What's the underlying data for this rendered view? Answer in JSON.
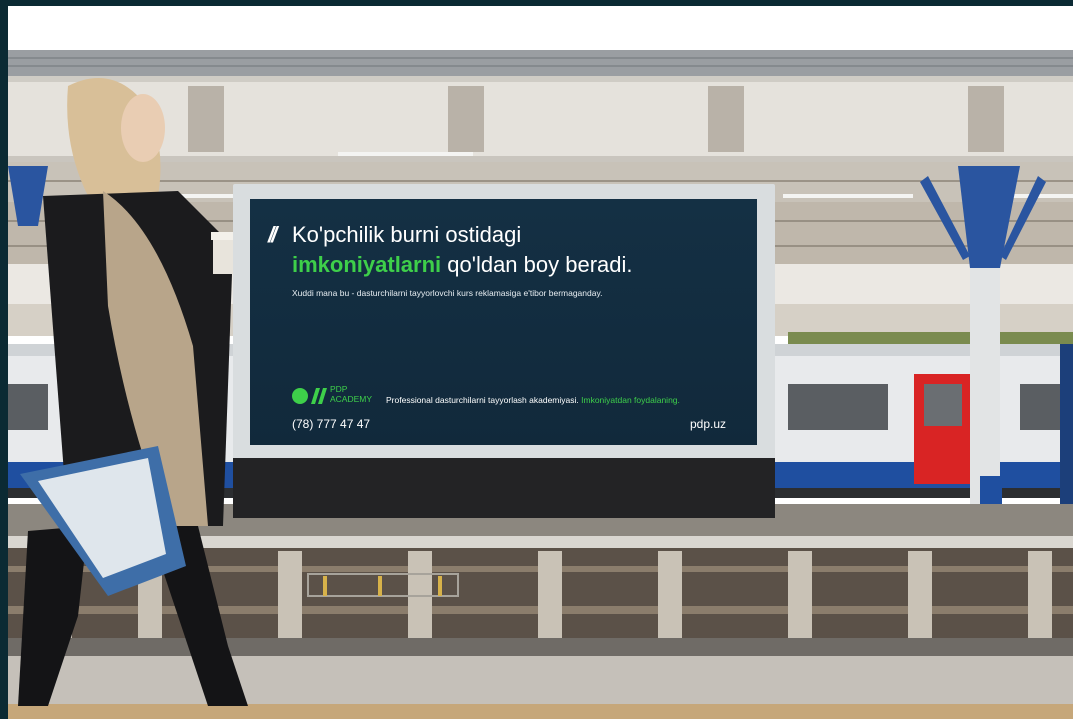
{
  "billboard": {
    "quote_mark": "//",
    "headline_line1": "Ko'pchilik burni ostidagi",
    "headline_highlight": "imkoniyatlarni",
    "headline_rest": " qo'ldan boy beradi.",
    "subline": "Xuddi mana bu - dasturchilarni tayyorlovchi kurs reklamasiga e'tibor bermaganday.",
    "logo_line1": "PDP",
    "logo_line2": "ACADEMY",
    "tagline": "Professional dasturchilarni tayyorlash akademiyasi.",
    "tagline_highlight": " Imkoniyatdan foydalaning.",
    "phone": "(78) 777 47 47",
    "website": "pdp.uz"
  },
  "colors": {
    "board_bg": "#133043",
    "accent_green": "#3ecf4a",
    "train_red": "#d92424",
    "train_blue": "#1f4fa0"
  }
}
